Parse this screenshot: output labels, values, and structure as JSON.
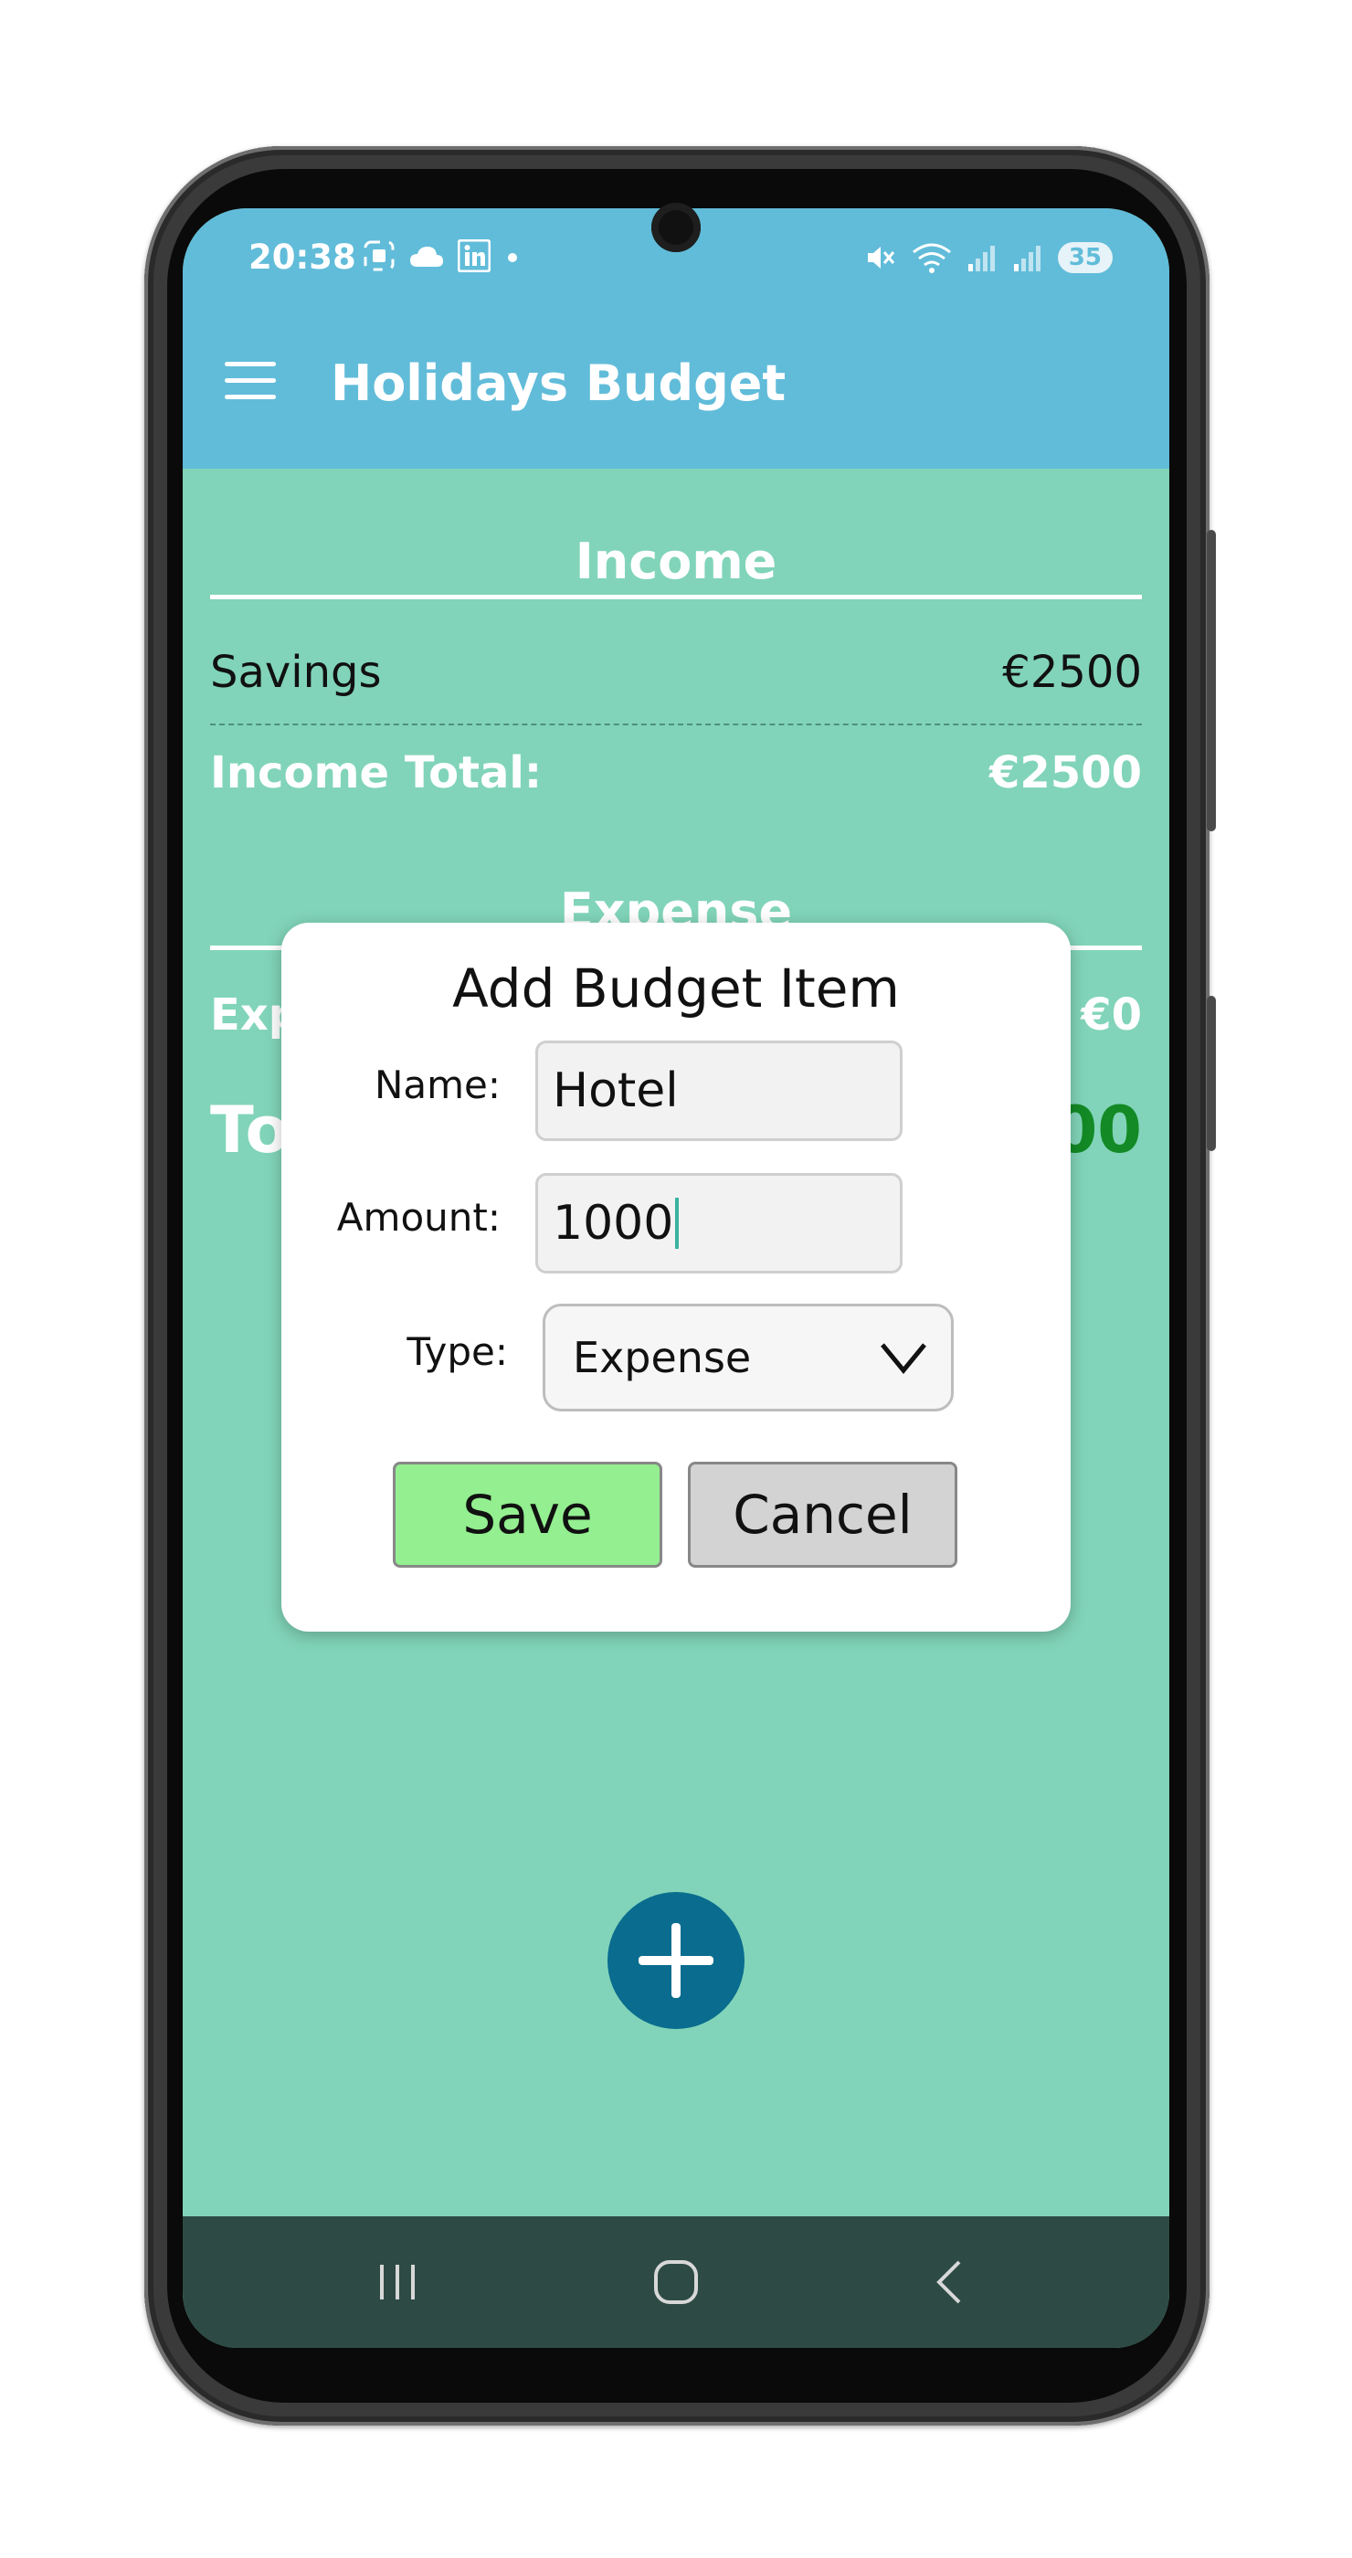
{
  "status_bar": {
    "time": "20:38",
    "left_icons": [
      "screenshot-icon",
      "cloud-icon",
      "linkedin-icon",
      "dot-icon"
    ],
    "right_icons": [
      "mute-icon",
      "wifi-icon",
      "signal-icon",
      "signal-icon"
    ],
    "battery": "35"
  },
  "app_bar": {
    "title": "Holidays Budget",
    "menu_icon": "hamburger-menu-icon"
  },
  "income": {
    "title": "Income",
    "items": [
      {
        "name": "Savings",
        "amount": "€2500"
      }
    ],
    "total_label": "Income Total:",
    "total_value": "€2500"
  },
  "expense": {
    "title": "Expense",
    "total_label_visible": "Exp",
    "total_value": "€0"
  },
  "summary": {
    "label_visible": "To",
    "value_visible": "00"
  },
  "dialog": {
    "title": "Add Budget Item",
    "name_label": "Name:",
    "name_value": "Hotel",
    "amount_label": "Amount:",
    "amount_value": "1000",
    "type_label": "Type:",
    "type_value": "Expense",
    "save_label": "Save",
    "cancel_label": "Cancel"
  },
  "fab": {
    "icon": "plus-icon"
  },
  "nav_bar": {
    "icons": [
      "recents-icon",
      "home-icon",
      "back-icon"
    ]
  },
  "colors": {
    "app_bar": "#61bcd9",
    "background": "#81d4b9",
    "fab": "#0a6c8e",
    "save_button": "#93ef90",
    "cancel_button": "#d3d3d3",
    "total_positive": "#138a25",
    "nav_bar": "#2d4b44"
  }
}
